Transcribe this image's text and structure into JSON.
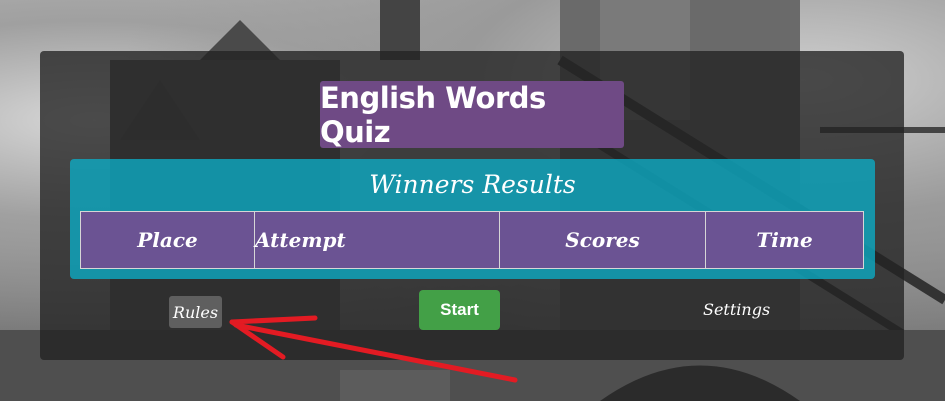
{
  "app": {
    "title": "English Words Quiz",
    "accent_color": "#6f4a85",
    "results_color": "#0caac3"
  },
  "results": {
    "heading": "Winners Results",
    "columns": [
      "Place",
      "Attempt",
      "Scores",
      "Time"
    ]
  },
  "controls": {
    "rules_label": "Rules",
    "start_label": "Start",
    "settings_label": "Settings",
    "start_color": "#43a047"
  },
  "annotation": {
    "arrow_color": "#e31b23",
    "arrow_target": "rules-button"
  }
}
